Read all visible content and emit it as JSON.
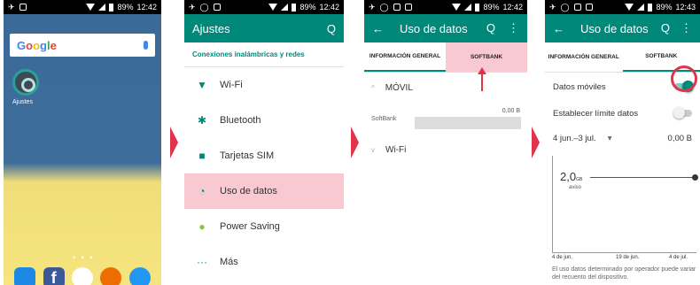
{
  "status": {
    "battery": "89%",
    "time": "12:42",
    "time4": "12:43"
  },
  "home": {
    "search": "Google",
    "app_label": "Ajustes",
    "dots": "• • •"
  },
  "settings": {
    "title": "Ajustes",
    "section": "Conexiones inalámbricas y redes",
    "items": [
      {
        "label": "Wi-Fi",
        "icon": "▼"
      },
      {
        "label": "Bluetooth",
        "icon": "✱"
      },
      {
        "label": "Tarjetas SIM",
        "icon": "■"
      },
      {
        "label": "Uso de datos",
        "icon": "◔"
      },
      {
        "label": "Power Saving",
        "icon": "●"
      },
      {
        "label": "Más",
        "icon": "···"
      }
    ]
  },
  "datos": {
    "title": "Uso de datos",
    "tab1": "INFORMACIÓN GENERAL",
    "tab2": "SOFTBANK",
    "movil": "MÓVIL",
    "softbank": "SoftBank",
    "value": "0,00 B",
    "wifi": "Wi-Fi",
    "search_icon": "Q",
    "menu_icon": "⋮",
    "back_icon": "←"
  },
  "detalle": {
    "title": "Uso de datos",
    "datos_moviles": "Datos móviles",
    "limite": "Establecer límite datos",
    "periodo": "4 jun.–3 jul.",
    "dropdown": "▾",
    "value": "0,00 B",
    "aviso_val": "2,0",
    "aviso_unit": "GB",
    "aviso": "aviso",
    "x_labels": [
      "4 de jun.",
      "19 de jun.",
      "4 de jul."
    ],
    "footer": "El uso datos determinado por operador puede variar del recuento del dispositivo."
  },
  "toggles": {
    "datos_moviles": true,
    "limite": false
  },
  "colors": {
    "accent": "#00897b",
    "highlight": "#f8c9d1",
    "annotation": "#e0344a"
  }
}
